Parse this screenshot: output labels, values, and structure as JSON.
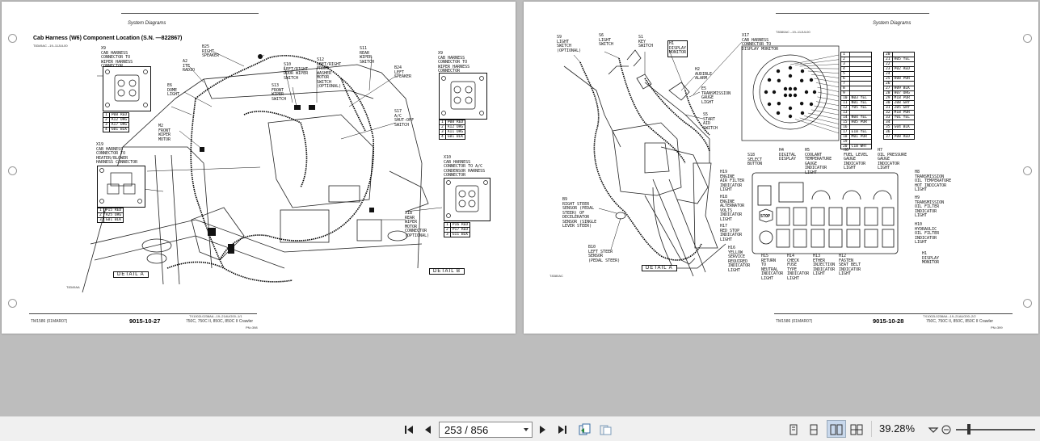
{
  "left_page": {
    "header": "System Diagrams",
    "title": "Cab Harness (W6) Component Location (S.N. —822867)",
    "ref_code": "T8349AC    –19–11JUL00",
    "detail_a": "DETAIL A",
    "detail_b": "DETAIL B",
    "fig_id": "T8349AA",
    "footer_small": "TX1002L0238AA  –19–21AUG00–1/1",
    "tm": "TM1586 (01MAR07)",
    "page_number": "9015-10-27",
    "models": "750C, 750C II, 850C, 850C II Crawler",
    "pn": "PN=398",
    "labels": {
      "x9": "X9\nCAB HARNESS\nCONNECTOR TO\nWIPER HARNESS\nCONNECTOR",
      "a2": "A2\nITE\nRADIO",
      "b25": "B25\nRIGHT\nSPEAKER",
      "s11": "S11\nREAR\nWIPER\nSWITCH",
      "s10": "S10\nLEFT/RIGHT\nDOOR WIPER\nSWITCH",
      "s12": "S12\nLEFT/RIGHT\nFRONT\nWASHER\nMOTOR\nSWITCH\n(OPTIONAL)",
      "b24": "B24\nLEFT\nSPEAKER",
      "x9b": "X9\nCAB HARNESS\nCONNECTOR TO\nWIPER HARNESS\nCONNECTOR",
      "e6": "E6\nDOME\nLIGHT",
      "s13": "S13\nFRONT\nWIPER\nSWITCH",
      "s17": "S17\nA/C\nSHUT-OFF\nSWITCH",
      "m2": "M2\nFRONT\nWIPER\nMOTOR",
      "x19": "X19\nCAB HARNESS\nCONNECTOR TO\nHEATER/BLOWER\nHARNESS CONNECTOR",
      "x10": "X10\nCAB HARNESS\nCONNECTOR TO A/C\nCONDENSOR HARNESS\nCONNECTOR",
      "x18": "X18\nREAR\nWIPER\nMOTOR\nCONNECTOR\n(OPTIONAL)"
    },
    "x9_pins": [
      [
        "1",
        "P08 RED"
      ],
      [
        "2",
        "A12 ORG"
      ],
      [
        "3",
        "A17 ORG"
      ],
      [
        "4",
        "G01 BLK"
      ]
    ],
    "x9b_pins": [
      [
        "1",
        "P08 RED"
      ],
      [
        "2",
        "A12 ORG"
      ],
      [
        "3",
        "A11 ORG"
      ],
      [
        "4",
        "G01 BLK"
      ]
    ],
    "x19_pins": [
      [
        "1",
        "P15 RED"
      ],
      [
        "2",
        "A25 ORG"
      ],
      [
        "3",
        "G01 BLK"
      ]
    ],
    "x10_pins": [
      [
        "1",
        "P16 RED"
      ],
      [
        "2",
        "P17 RED"
      ],
      [
        "3",
        "G11 BLK"
      ]
    ]
  },
  "right_page": {
    "header": "System Diagrams",
    "ref_code": "T8380AC    –19–11JUL00",
    "detail_a": "DETAIL A",
    "fig_id": "T8380AC",
    "footer_small": "TX1002L0238AA  –19–21AUG00–2/2",
    "tm": "TM1586 (01MAR07)",
    "page_number": "9015-10-28",
    "models": "750C, 750C II, 850C, 850C II Crawler",
    "pn": "PN=399",
    "labels": {
      "s9": "S9\nLIGHT\nSWITCH\n(OPTIONAL)",
      "s6": "S6\nLIGHT\nSWITCH",
      "s1": "S1\nKEY\nSWITCH",
      "h1": "H1\nDISPLAY\nMONITOR",
      "x17": "X17\nCAB HARNESS\nCONNECTOR TO\nDISPLAY MONITOR",
      "h2": "H2\nAUDIBLE\nALARM",
      "e5": "E5\nTRANSMISSION\nGAUGE\nLIGHT",
      "s5": "S5\nSTART\nAID\nSWITCH",
      "b9": "B9\nRIGHT STEER\nSENSOR (PEDAL\nSTEER) OF\nDECELERATOR\nSENSOR (SINGLE\nLEVER STEER)",
      "b10": "B10\nLEFT STEER\nSENSOR\n(PEDAL STEER)",
      "s18": "S18\nSELECT\nBUTTON",
      "h4": "H4\nDIGITAL\nDISPLAY",
      "h5": "H5\nCOOLANT\nTEMPERATURE\nGAUGE\nINDICATOR\nLIGHT",
      "h6": "H6\nFUEL LEVEL\nGAUGE\nINDICATOR\nLIGHT",
      "h7": "H7\nOIL PRESSURE\nGAUGE\nINDICATOR\nLIGHT",
      "h8": "H8\nTRANSMISSION\nOIL TEMPERATURE\nHOT INDICATOR\nLIGHT",
      "h9": "H9\nTRANSMISSION\nOIL FILTER\nINDICATOR\nLIGHT",
      "h10": "H10\nHYDRAULIC\nOIL FILTER\nINDICATOR\nLIGHT",
      "h1b": "H1\nDISPLAY\nMONITOR",
      "h19": "H19\nENGINE\nAIR FILTER\nINDICATOR\nLIGHT",
      "h18": "H18\nENGINE\nALTERNATOR\nVOLTS\nINDICATOR\nLIGHT",
      "h17": "H17\nRED STOP\nINDICATOR\nLIGHT",
      "h16": "H16\nYELLOW\nSERVICE\nREQUIRED\nINDICATOR\nLIGHT",
      "h15": "H15\nRETURN\nTO\nNEUTRAL\nINDICATOR\nLIGHT",
      "h14": "H14\nCHECK\nFUSE\nTYPE\nINDICATOR\nLIGHT",
      "h13": "H13\nETHER\nINJECTION\nINDICATOR\nLIGHT",
      "h12": "H12\nFASTEN\nSEAT BELT\nINDICATOR\nLIGHT",
      "stop": "STOP"
    },
    "pin_left": [
      [
        "1",
        ""
      ],
      [
        "2",
        ""
      ],
      [
        "3",
        ""
      ],
      [
        "4",
        ""
      ],
      [
        "5",
        ""
      ],
      [
        "6",
        ""
      ],
      [
        "7",
        ""
      ],
      [
        "8",
        ""
      ],
      [
        "9",
        ""
      ],
      [
        "10",
        "N03 YEL"
      ],
      [
        "11",
        "N01 YEL"
      ],
      [
        "12",
        "Y05 YEL"
      ],
      [
        "13",
        ""
      ],
      [
        "14",
        "N04 YEL"
      ],
      [
        "15",
        "H05 PUR"
      ],
      [
        "16",
        ""
      ],
      [
        "17",
        "E10 YEL"
      ],
      [
        "18",
        "M01 PUR"
      ],
      [
        "19",
        ""
      ],
      [
        "20",
        "C10 WHT"
      ]
    ],
    "pin_right": [
      [
        "20",
        ""
      ],
      [
        "21",
        "R05 YEL"
      ],
      [
        "22",
        ""
      ],
      [
        "23",
        "P02 RED"
      ],
      [
        "24",
        ""
      ],
      [
        "25",
        "H08 PUR"
      ],
      [
        "26",
        ""
      ],
      [
        "27",
        "H09 BLK"
      ],
      [
        "28",
        "H07 ORG"
      ],
      [
        "29",
        "M18 PUR"
      ],
      [
        "30",
        "Z08 GRY"
      ],
      [
        "31",
        "Z05 GRY"
      ],
      [
        "32",
        "M18 PUR"
      ],
      [
        "33",
        "Y01 YEL"
      ],
      [
        "34",
        ""
      ],
      [
        "35",
        "G04 BLK"
      ],
      [
        "36",
        ""
      ],
      [
        "37",
        "P08 RED"
      ]
    ]
  },
  "statusbar": {
    "page_value": "253 / 856",
    "zoom_value": "39.28%"
  }
}
